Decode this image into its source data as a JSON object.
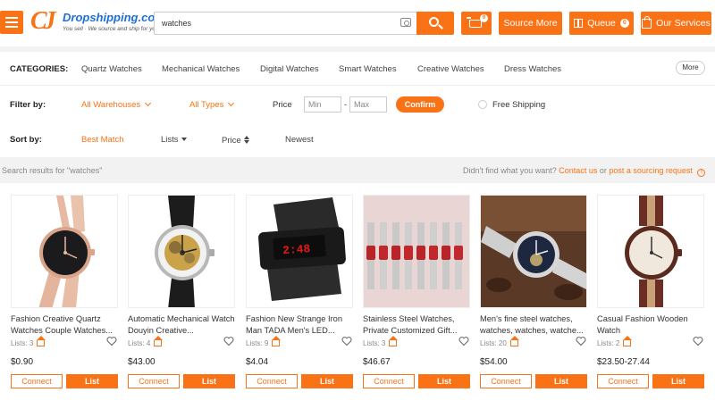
{
  "header": {
    "logo_mark": "CJ",
    "logo_name": "Dropshipping.com",
    "logo_tagline": "You sell · We source and ship for you!",
    "search_value": "watches",
    "cart_count": "0",
    "source_more_label": "Source More",
    "queue_label": "Queue",
    "queue_count": "0",
    "our_services_label": "Our Services",
    "accent_color": "#f97316"
  },
  "categories": {
    "label": "CATEGORIES:",
    "items": [
      "Quartz Watches",
      "Mechanical Watches",
      "Digital Watches",
      "Smart Watches",
      "Creative Watches",
      "Dress Watches"
    ],
    "more_label": "More"
  },
  "filter": {
    "label": "Filter by:",
    "warehouses": "All Warehouses",
    "types": "All Types",
    "price_label": "Price",
    "min_placeholder": "Min",
    "max_placeholder": "Max",
    "dash": "-",
    "confirm_label": "Confirm",
    "free_shipping_label": "Free Shipping"
  },
  "sort": {
    "label": "Sort by:",
    "best_match": "Best Match",
    "lists": "Lists",
    "price": "Price",
    "newest": "Newest"
  },
  "results": {
    "text": "Search results for \"watches\"",
    "not_found": "Didn't find what you want?",
    "contact_us": "Contact us",
    "or": "or",
    "sourcing_request": "post a sourcing request",
    "info_mark": "!"
  },
  "products": [
    {
      "title": "Fashion Creative Quartz Watches Couple Watches...",
      "lists": "Lists: 3",
      "price": "$0.90",
      "connect": "Connect",
      "list": "List"
    },
    {
      "title": "Automatic Mechanical Watch Douyin Creative...",
      "lists": "Lists: 4",
      "price": "$43.00",
      "connect": "Connect",
      "list": "List"
    },
    {
      "title": "Fashion New Strange Iron Man TADA Men's LED...",
      "lists": "Lists: 9",
      "price": "$4.04",
      "connect": "Connect",
      "list": "List"
    },
    {
      "title": "Stainless Steel Watches, Private Customized Gift...",
      "lists": "Lists: 3",
      "price": "$46.67",
      "connect": "Connect",
      "list": "List"
    },
    {
      "title": "Men's fine steel watches, watches, watches, watche...",
      "lists": "Lists: 20",
      "price": "$54.00",
      "connect": "Connect",
      "list": "List"
    },
    {
      "title": "Casual Fashion Wooden Watch",
      "lists": "Lists: 2",
      "price": "$23.50-27.44",
      "connect": "Connect",
      "list": "List"
    }
  ]
}
